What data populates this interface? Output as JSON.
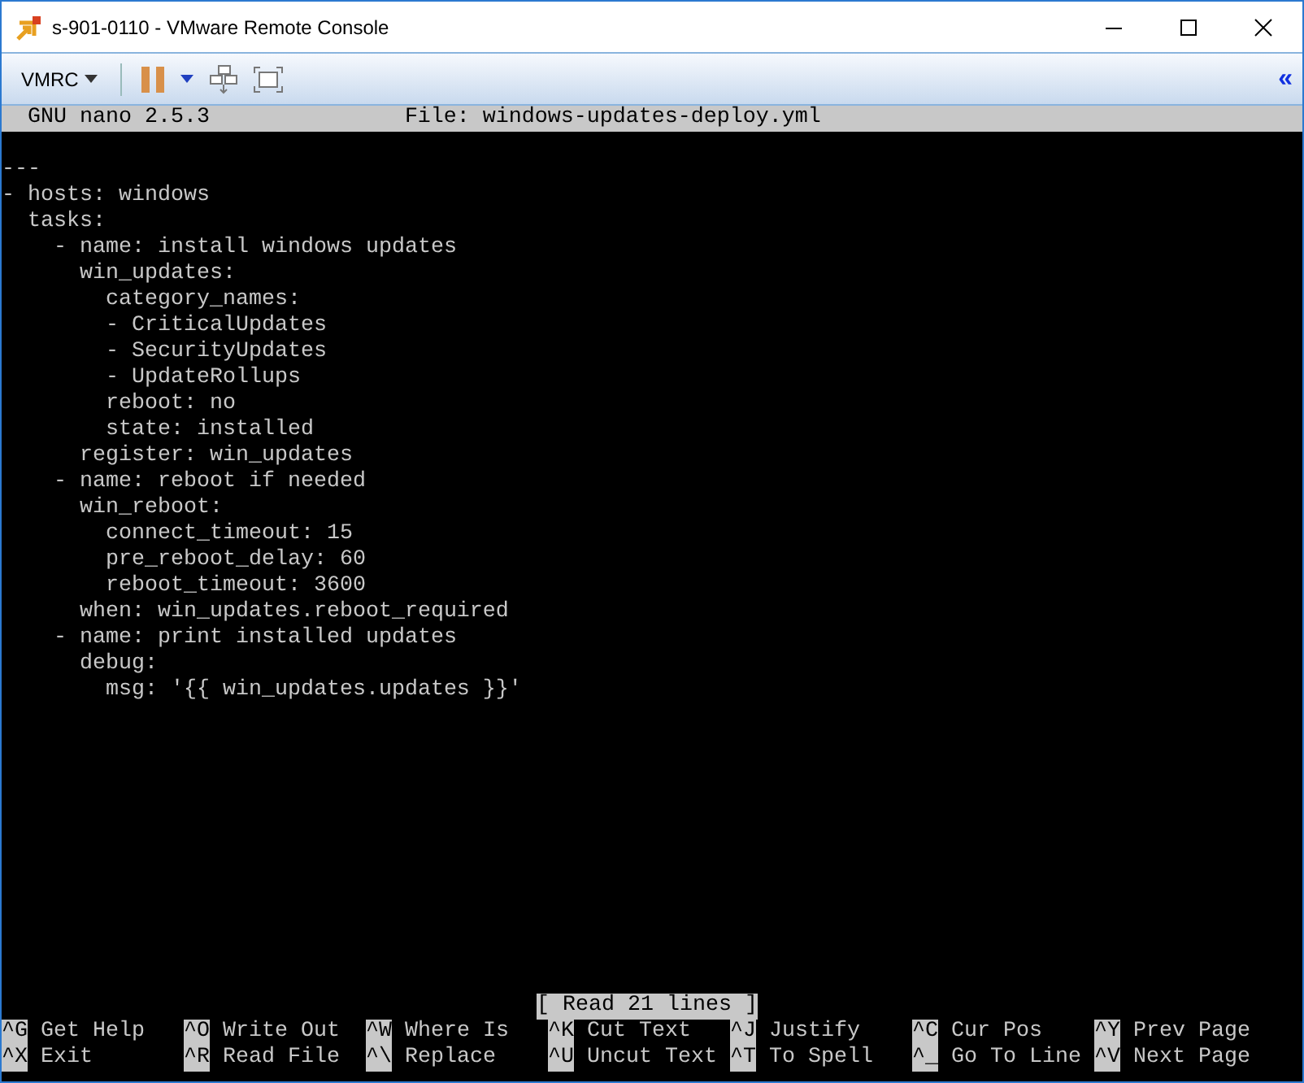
{
  "window": {
    "title": "s-901-0110 - VMware Remote Console"
  },
  "toolbar": {
    "menu": "VMRC",
    "collapse": "«"
  },
  "nano": {
    "version": "GNU nano 2.5.3",
    "file": "File: windows-updates-deploy.yml",
    "lines": [
      "---",
      "- hosts: windows",
      "  tasks:",
      "    - name: install windows updates",
      "      win_updates:",
      "        category_names:",
      "        - CriticalUpdates",
      "        - SecurityUpdates",
      "        - UpdateRollups",
      "        reboot: no",
      "        state: installed",
      "      register: win_updates",
      "    - name: reboot if needed",
      "      win_reboot:",
      "        connect_timeout: 15",
      "        pre_reboot_delay: 60",
      "        reboot_timeout: 3600",
      "      when: win_updates.reboot_required",
      "    - name: print installed updates",
      "      debug:",
      "        msg: '{{ win_updates.updates }}'"
    ],
    "status": "[ Read 21 lines ]",
    "shortcuts": [
      [
        {
          "key": "^G",
          "label": "Get Help"
        },
        {
          "key": "^O",
          "label": "Write Out"
        },
        {
          "key": "^W",
          "label": "Where Is"
        },
        {
          "key": "^K",
          "label": "Cut Text"
        },
        {
          "key": "^J",
          "label": "Justify"
        },
        {
          "key": "^C",
          "label": "Cur Pos"
        },
        {
          "key": "^Y",
          "label": "Prev Page"
        }
      ],
      [
        {
          "key": "^X",
          "label": "Exit"
        },
        {
          "key": "^R",
          "label": "Read File"
        },
        {
          "key": "^\\",
          "label": "Replace"
        },
        {
          "key": "^U",
          "label": "Uncut Text"
        },
        {
          "key": "^T",
          "label": "To Spell"
        },
        {
          "key": "^_",
          "label": "Go To Line"
        },
        {
          "key": "^V",
          "label": "Next Page"
        }
      ]
    ]
  }
}
